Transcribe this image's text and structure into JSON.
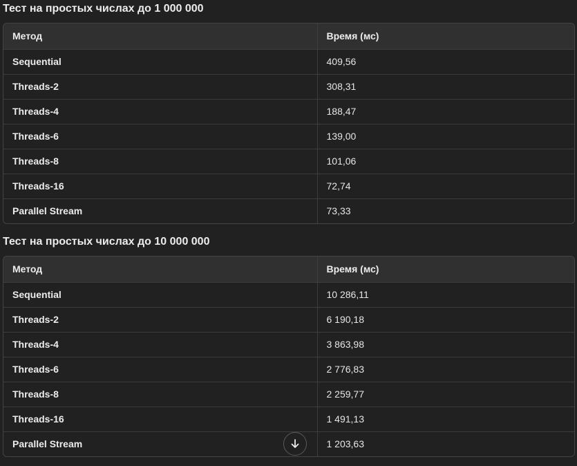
{
  "sections": [
    {
      "title": "Тест на простых числах до 1 000 000",
      "headers": [
        "Метод",
        "Время (мс)"
      ],
      "rows": [
        [
          "Sequential",
          "409,56"
        ],
        [
          "Threads-2",
          "308,31"
        ],
        [
          "Threads-4",
          "188,47"
        ],
        [
          "Threads-6",
          "139,00"
        ],
        [
          "Threads-8",
          "101,06"
        ],
        [
          "Threads-16",
          "72,74"
        ],
        [
          "Parallel Stream",
          "73,33"
        ]
      ]
    },
    {
      "title": "Тест на простых числах до 10 000 000",
      "headers": [
        "Метод",
        "Время (мс)"
      ],
      "rows": [
        [
          "Sequential",
          "10 286,11"
        ],
        [
          "Threads-2",
          "6 190,18"
        ],
        [
          "Threads-4",
          "3 863,98"
        ],
        [
          "Threads-6",
          "2 776,83"
        ],
        [
          "Threads-8",
          "2 259,77"
        ],
        [
          "Threads-16",
          "1 491,13"
        ],
        [
          "Parallel Stream",
          "1 203,63"
        ]
      ]
    }
  ],
  "scroll_button": {
    "icon": "arrow-down-icon"
  }
}
